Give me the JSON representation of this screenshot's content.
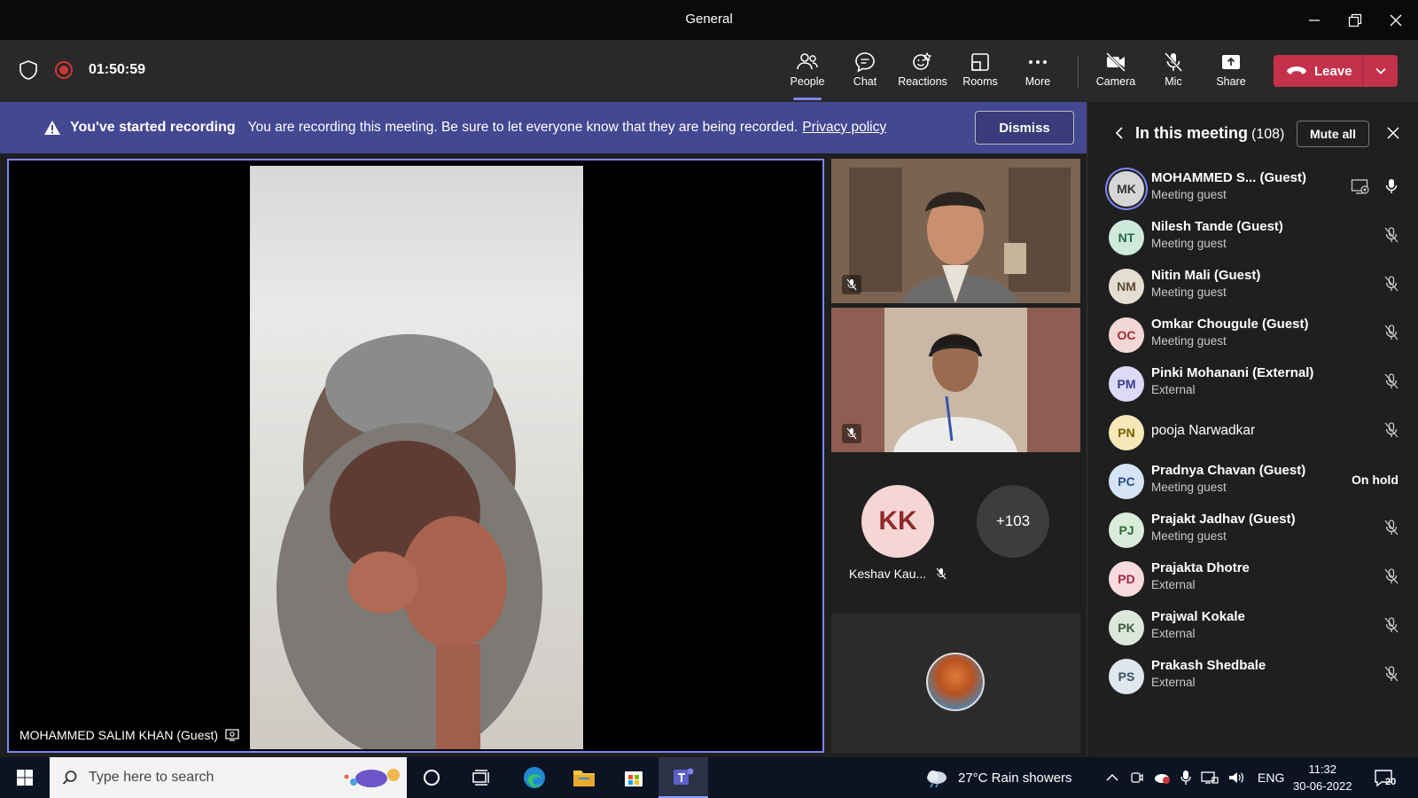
{
  "window": {
    "title": "General"
  },
  "toolbar": {
    "timer": "01:50:59",
    "buttons": {
      "people": "People",
      "chat": "Chat",
      "reactions": "Reactions",
      "rooms": "Rooms",
      "more": "More",
      "camera": "Camera",
      "mic": "Mic",
      "share": "Share"
    },
    "leave_label": "Leave"
  },
  "banner": {
    "title": "You've started recording",
    "text": "You are recording this meeting. Be sure to let everyone know that they are being recorded.",
    "link": "Privacy policy",
    "dismiss": "Dismiss"
  },
  "stage": {
    "main_name": "MOHAMMED SALIM KHAN (Guest)",
    "kk_initials": "KK",
    "kk_name": "Keshav Kau...",
    "more_count": "+103"
  },
  "panel": {
    "title": "In this meeting",
    "count": "(108)",
    "mute_all": "Mute all",
    "participants": [
      {
        "initials": "MK",
        "name": "MOHAMMED S...  (Guest)",
        "sub": "Meeting guest",
        "bg": "#d6d6d6",
        "fg": "#333333",
        "state": "speaking"
      },
      {
        "initials": "NT",
        "name": "Nilesh Tande (Guest)",
        "sub": "Meeting guest",
        "bg": "#cfe9dc",
        "fg": "#1f6b46",
        "state": "muted"
      },
      {
        "initials": "NM",
        "name": "Nitin Mali (Guest)",
        "sub": "Meeting guest",
        "bg": "#e4ddd2",
        "fg": "#5b4a32",
        "state": "muted"
      },
      {
        "initials": "OC",
        "name": "Omkar Chougule (Guest)",
        "sub": "Meeting guest",
        "bg": "#f3d6d6",
        "fg": "#a02b2b",
        "state": "muted"
      },
      {
        "initials": "PM",
        "name": "Pinki Mohanani (External)",
        "sub": "External",
        "bg": "#dcdaf4",
        "fg": "#3e3a8f",
        "state": "muted"
      },
      {
        "initials": "PN",
        "name": "pooja Narwadkar",
        "sub": "",
        "bg": "#f7e8b8",
        "fg": "#7a5d00",
        "state": "muted"
      },
      {
        "initials": "PC",
        "name": "Pradnya Chavan (Guest)",
        "sub": "Meeting guest",
        "bg": "#d5e4f5",
        "fg": "#234f84",
        "state": "hold",
        "hold_label": "On hold"
      },
      {
        "initials": "PJ",
        "name": "Prajakt Jadhav (Guest)",
        "sub": "Meeting guest",
        "bg": "#d8ecd9",
        "fg": "#2d6a31",
        "state": "muted"
      },
      {
        "initials": "PD",
        "name": "Prajakta Dhotre",
        "sub": "External",
        "bg": "#f7dadd",
        "fg": "#a3263a",
        "state": "muted"
      },
      {
        "initials": "PK",
        "name": "Prajwal Kokale",
        "sub": "External",
        "bg": "#dde7dc",
        "fg": "#3d5a3a",
        "state": "muted"
      },
      {
        "initials": "PS",
        "name": "Prakash Shedbale",
        "sub": "External",
        "bg": "#dfe6ee",
        "fg": "#3a4f66",
        "state": "muted"
      }
    ]
  },
  "taskbar": {
    "search_placeholder": "Type here to search",
    "weather": "27°C  Rain showers",
    "lang": "ENG",
    "time": "11:32",
    "date": "30-06-2022",
    "notifications": "20"
  },
  "colors": {
    "accent": "#7f85f5",
    "leave": "#c4314b",
    "banner": "#444791",
    "record": "#d13438"
  }
}
